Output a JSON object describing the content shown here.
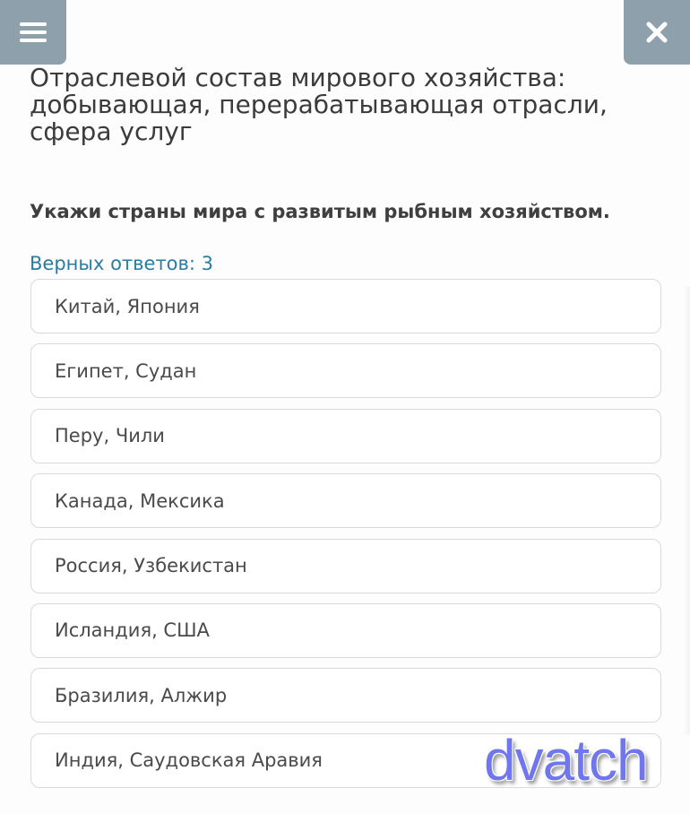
{
  "header": {
    "menu_icon": "hamburger-menu-icon",
    "close_icon": "close-icon",
    "accent_color": "#8fa0ad"
  },
  "lesson": {
    "title": "Отраслевой состав мирового хозяйства: добывающая, перерабатывающая отрасли, сфера услуг"
  },
  "question": {
    "text": "Укажи страны мира с развитым рыбным хозяйством.",
    "correct_count_label": "Верных ответов: 3"
  },
  "options": [
    {
      "label": "Китай, Япония"
    },
    {
      "label": "Египет, Судан"
    },
    {
      "label": "Перу, Чили"
    },
    {
      "label": "Канада, Мексика"
    },
    {
      "label": "Россия, Узбекистан"
    },
    {
      "label": "Исландия, США"
    },
    {
      "label": "Бразилия, Алжир"
    },
    {
      "label": "Индия, Саудовская Аравия"
    }
  ],
  "watermark": {
    "text": "dvatch",
    "color": "#6f76ee"
  }
}
